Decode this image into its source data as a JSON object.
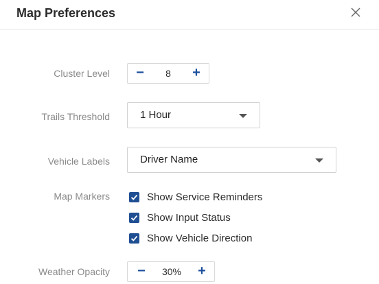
{
  "dialog": {
    "title": "Map Preferences",
    "close_icon": "close-icon"
  },
  "cluster_level": {
    "label": "Cluster Level",
    "value": "8",
    "decrement": "−",
    "increment": "+"
  },
  "trails_threshold": {
    "label": "Trails Threshold",
    "selected": "1 Hour"
  },
  "vehicle_labels": {
    "label": "Vehicle Labels",
    "selected": "Driver Name"
  },
  "map_markers": {
    "label": "Map Markers",
    "options": [
      {
        "label": "Show Service Reminders",
        "checked": true
      },
      {
        "label": "Show Input Status",
        "checked": true
      },
      {
        "label": "Show Vehicle Direction",
        "checked": true
      }
    ]
  },
  "weather_opacity": {
    "label": "Weather Opacity",
    "value": "30%",
    "decrement": "−",
    "increment": "+"
  },
  "colors": {
    "accent": "#1f4e92",
    "label_gray": "#8a8a8a"
  }
}
